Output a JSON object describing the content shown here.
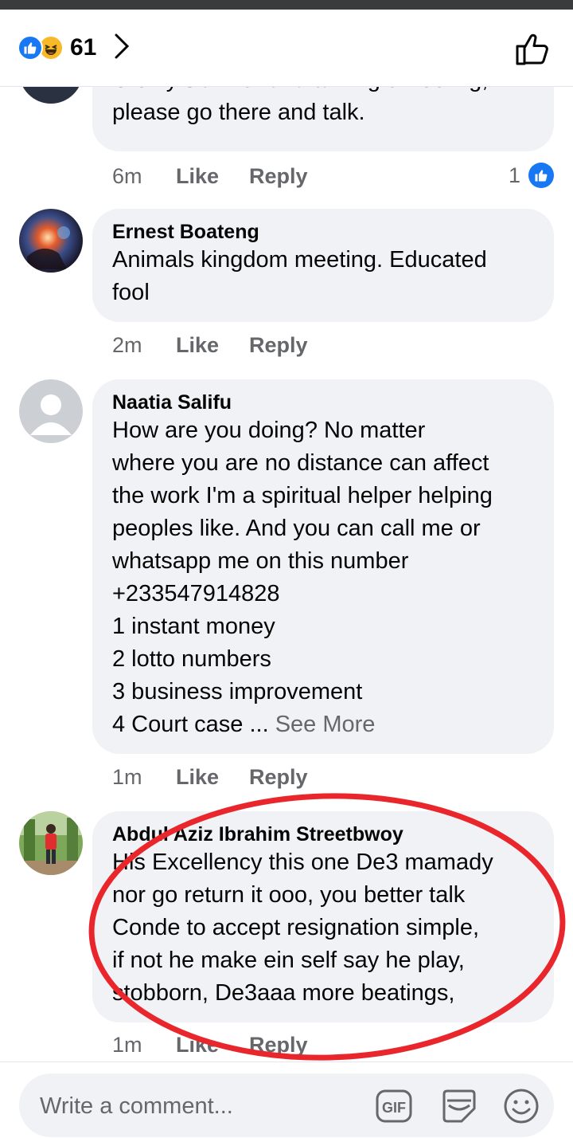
{
  "header": {
    "reaction_count": "61",
    "reactions": [
      "like-icon",
      "haha-icon"
    ]
  },
  "comments": [
    {
      "author": "",
      "text": "U only sit in Ghana  talking ur feeling,\nplease  go there  and talk.",
      "time": "6m",
      "like_label": "Like",
      "reply_label": "Reply",
      "reaction_count": "1"
    },
    {
      "author": "Ernest Boateng",
      "text": "Animals kingdom meeting. Educated\nfool",
      "time": "2m",
      "like_label": "Like",
      "reply_label": "Reply"
    },
    {
      "author": "Naatia Salifu",
      "text": "How are you doing?  No matter\nwhere you are no distance can affect\nthe work I'm a spiritual helper helping\npeoples like. And you can call me or\nwhatsapp me on this number\n+233547914828\n1 instant money\n2 lotto numbers\n3 business improvement\n4 Court case ... ",
      "see_more": "See More",
      "time": "1m",
      "like_label": "Like",
      "reply_label": "Reply"
    },
    {
      "author": "Abdul Aziz Ibrahim Streetbwoy",
      "text": "His Excellency this one De3 mamady\nnor go return it ooo, you better talk\nConde to accept resignation simple,\nif not he make ein self say he play,\nstobborn, De3aaa more beatings,",
      "time": "1m",
      "like_label": "Like",
      "reply_label": "Reply"
    }
  ],
  "composer": {
    "placeholder": "Write a comment..."
  },
  "colors": {
    "accent": "#1877f2",
    "bubble": "#f0f2f5",
    "secondary_text": "#65676b",
    "annotation": "#e8262c"
  }
}
